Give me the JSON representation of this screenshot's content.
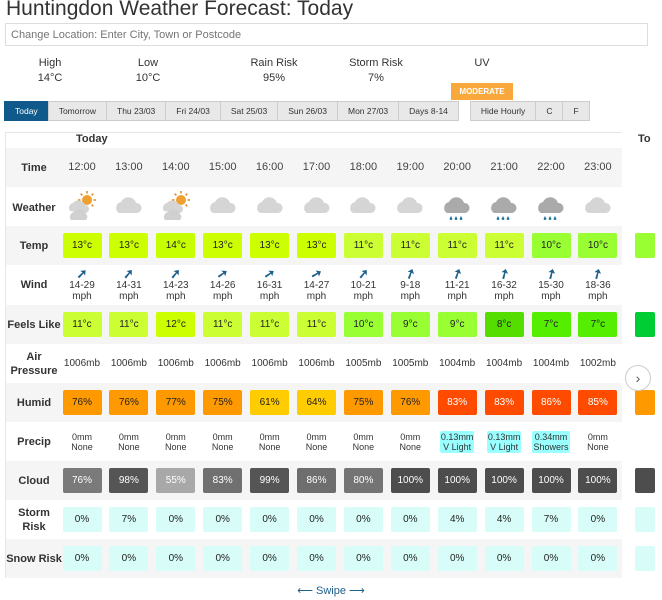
{
  "title": "Huntingdon Weather Forecast: Today",
  "search": {
    "placeholder": "Change Location: Enter City, Town or Postcode"
  },
  "summary": [
    {
      "label": "High",
      "value": "14°C"
    },
    {
      "label": "Low",
      "value": "10°C"
    },
    {
      "label": "Rain Risk",
      "value": "95%"
    },
    {
      "label": "Storm Risk",
      "value": "7%"
    },
    {
      "label": "UV",
      "value": "MODERATE",
      "color": "#f9a93b"
    }
  ],
  "tabs": [
    "Today",
    "Tomorrow",
    "Thu 23/03",
    "Fri 24/03",
    "Sat 25/03",
    "Sun 26/03",
    "Mon 27/03",
    "Days 8-14"
  ],
  "options": [
    "Hide Hourly",
    "C",
    "F"
  ],
  "day_header": "Today",
  "next_day_header": "To",
  "row_labels": {
    "time": "Time",
    "weather": "Weather",
    "temp": "Temp",
    "wind": "Wind",
    "feels": "Feels Like",
    "pressure": "Air Pressure",
    "humid": "Humid",
    "precip": "Precip",
    "cloud": "Cloud",
    "storm": "Storm Risk",
    "snow": "Snow Risk"
  },
  "hours": [
    {
      "time": "12:00",
      "weather": "sun-cloud",
      "temp": "13°c",
      "temp_color": "#ccff00",
      "wind": "14-29",
      "wind_unit": "mph",
      "wind_dir": 45,
      "feels": "11°c",
      "feels_color": "#ccff33",
      "pressure": "1006mb",
      "humid": "76%",
      "humid_color": "#ff9900",
      "precip": "0mm",
      "precip_type": "None",
      "cloud": "76%",
      "cloud_color": "#7a7a7a",
      "storm": "0%",
      "snow": "0%"
    },
    {
      "time": "13:00",
      "weather": "cloud",
      "temp": "13°c",
      "temp_color": "#ccff00",
      "wind": "14-31",
      "wind_unit": "mph",
      "wind_dir": 40,
      "feels": "11°c",
      "feels_color": "#ccff33",
      "pressure": "1006mb",
      "humid": "76%",
      "humid_color": "#ff9900",
      "precip": "0mm",
      "precip_type": "None",
      "cloud": "98%",
      "cloud_color": "#555555",
      "storm": "7%",
      "snow": "0%"
    },
    {
      "time": "14:00",
      "weather": "sun-cloud",
      "temp": "14°c",
      "temp_color": "#c6ff00",
      "wind": "14-23",
      "wind_unit": "mph",
      "wind_dir": 40,
      "feels": "12°c",
      "feels_color": "#ccff00",
      "pressure": "1006mb",
      "humid": "77%",
      "humid_color": "#ff9900",
      "precip": "0mm",
      "precip_type": "None",
      "cloud": "55%",
      "cloud_color": "#a8a8a8",
      "storm": "0%",
      "snow": "0%"
    },
    {
      "time": "15:00",
      "weather": "cloud",
      "temp": "13°c",
      "temp_color": "#ccff00",
      "wind": "14-26",
      "wind_unit": "mph",
      "wind_dir": 55,
      "feels": "11°c",
      "feels_color": "#ccff33",
      "pressure": "1006mb",
      "humid": "75%",
      "humid_color": "#ff9900",
      "precip": "0mm",
      "precip_type": "None",
      "cloud": "83%",
      "cloud_color": "#707070",
      "storm": "0%",
      "snow": "0%"
    },
    {
      "time": "16:00",
      "weather": "cloud",
      "temp": "13°c",
      "temp_color": "#ccff00",
      "wind": "16-31",
      "wind_unit": "mph",
      "wind_dir": 55,
      "feels": "11°c",
      "feels_color": "#ccff33",
      "pressure": "1006mb",
      "humid": "61%",
      "humid_color": "#ffcc00",
      "precip": "0mm",
      "precip_type": "None",
      "cloud": "99%",
      "cloud_color": "#555555",
      "storm": "0%",
      "snow": "0%"
    },
    {
      "time": "17:00",
      "weather": "cloud",
      "temp": "13°c",
      "temp_color": "#ccff00",
      "wind": "14-27",
      "wind_unit": "mph",
      "wind_dir": 60,
      "feels": "11°c",
      "feels_color": "#ccff33",
      "pressure": "1006mb",
      "humid": "64%",
      "humid_color": "#ffcc00",
      "precip": "0mm",
      "precip_type": "None",
      "cloud": "86%",
      "cloud_color": "#6e6e6e",
      "storm": "0%",
      "snow": "0%"
    },
    {
      "time": "18:00",
      "weather": "cloud",
      "temp": "11°c",
      "temp_color": "#ccff33",
      "wind": "10-21",
      "wind_unit": "mph",
      "wind_dir": 40,
      "feels": "10°c",
      "feels_color": "#99ff33",
      "pressure": "1005mb",
      "humid": "75%",
      "humid_color": "#ff9900",
      "precip": "0mm",
      "precip_type": "None",
      "cloud": "80%",
      "cloud_color": "#747474",
      "storm": "0%",
      "snow": "0%"
    },
    {
      "time": "19:00",
      "weather": "cloud",
      "temp": "11°c",
      "temp_color": "#ccff33",
      "wind": "9-18",
      "wind_unit": "mph",
      "wind_dir": 20,
      "feels": "9°c",
      "feels_color": "#99ff33",
      "pressure": "1005mb",
      "humid": "76%",
      "humid_color": "#ff9900",
      "precip": "0mm",
      "precip_type": "None",
      "cloud": "100%",
      "cloud_color": "#4d4d4d",
      "storm": "0%",
      "snow": "0%"
    },
    {
      "time": "20:00",
      "weather": "rain",
      "temp": "11°c",
      "temp_color": "#ccff33",
      "wind": "11-21",
      "wind_unit": "mph",
      "wind_dir": 20,
      "feels": "9°c",
      "feels_color": "#99ff33",
      "pressure": "1004mb",
      "humid": "83%",
      "humid_color": "#ff4b00",
      "precip": "0.13mm",
      "precip_type": "V Light",
      "precip_color": "#99ffff",
      "cloud": "100%",
      "cloud_color": "#4d4d4d",
      "storm": "4%",
      "snow": "0%"
    },
    {
      "time": "21:00",
      "weather": "rain",
      "temp": "11°c",
      "temp_color": "#ccff33",
      "wind": "16-32",
      "wind_unit": "mph",
      "wind_dir": 15,
      "feels": "8°c",
      "feels_color": "#55dd00",
      "pressure": "1004mb",
      "humid": "83%",
      "humid_color": "#ff4b00",
      "precip": "0.13mm",
      "precip_type": "V Light",
      "precip_color": "#99ffff",
      "cloud": "100%",
      "cloud_color": "#4d4d4d",
      "storm": "4%",
      "snow": "0%"
    },
    {
      "time": "22:00",
      "weather": "rain",
      "temp": "10°c",
      "temp_color": "#99ff33",
      "wind": "15-30",
      "wind_unit": "mph",
      "wind_dir": 15,
      "feels": "7°c",
      "feels_color": "#55ee00",
      "pressure": "1004mb",
      "humid": "86%",
      "humid_color": "#ff4b00",
      "precip": "0.34mm",
      "precip_type": "Showers",
      "precip_color": "#99ffff",
      "cloud": "100%",
      "cloud_color": "#4d4d4d",
      "storm": "7%",
      "snow": "0%"
    },
    {
      "time": "23:00",
      "weather": "cloud",
      "temp": "10°c",
      "temp_color": "#99ff33",
      "wind": "18-36",
      "wind_unit": "mph",
      "wind_dir": 15,
      "feels": "7°c",
      "feels_color": "#55ee00",
      "pressure": "1002mb",
      "humid": "85%",
      "humid_color": "#ff4b00",
      "precip": "0mm",
      "precip_type": "None",
      "cloud": "100%",
      "cloud_color": "#4d4d4d",
      "storm": "0%",
      "snow": "0%"
    }
  ],
  "risk_color": "#d8fdf8",
  "swipe": "⟵ Swipe ⟶"
}
